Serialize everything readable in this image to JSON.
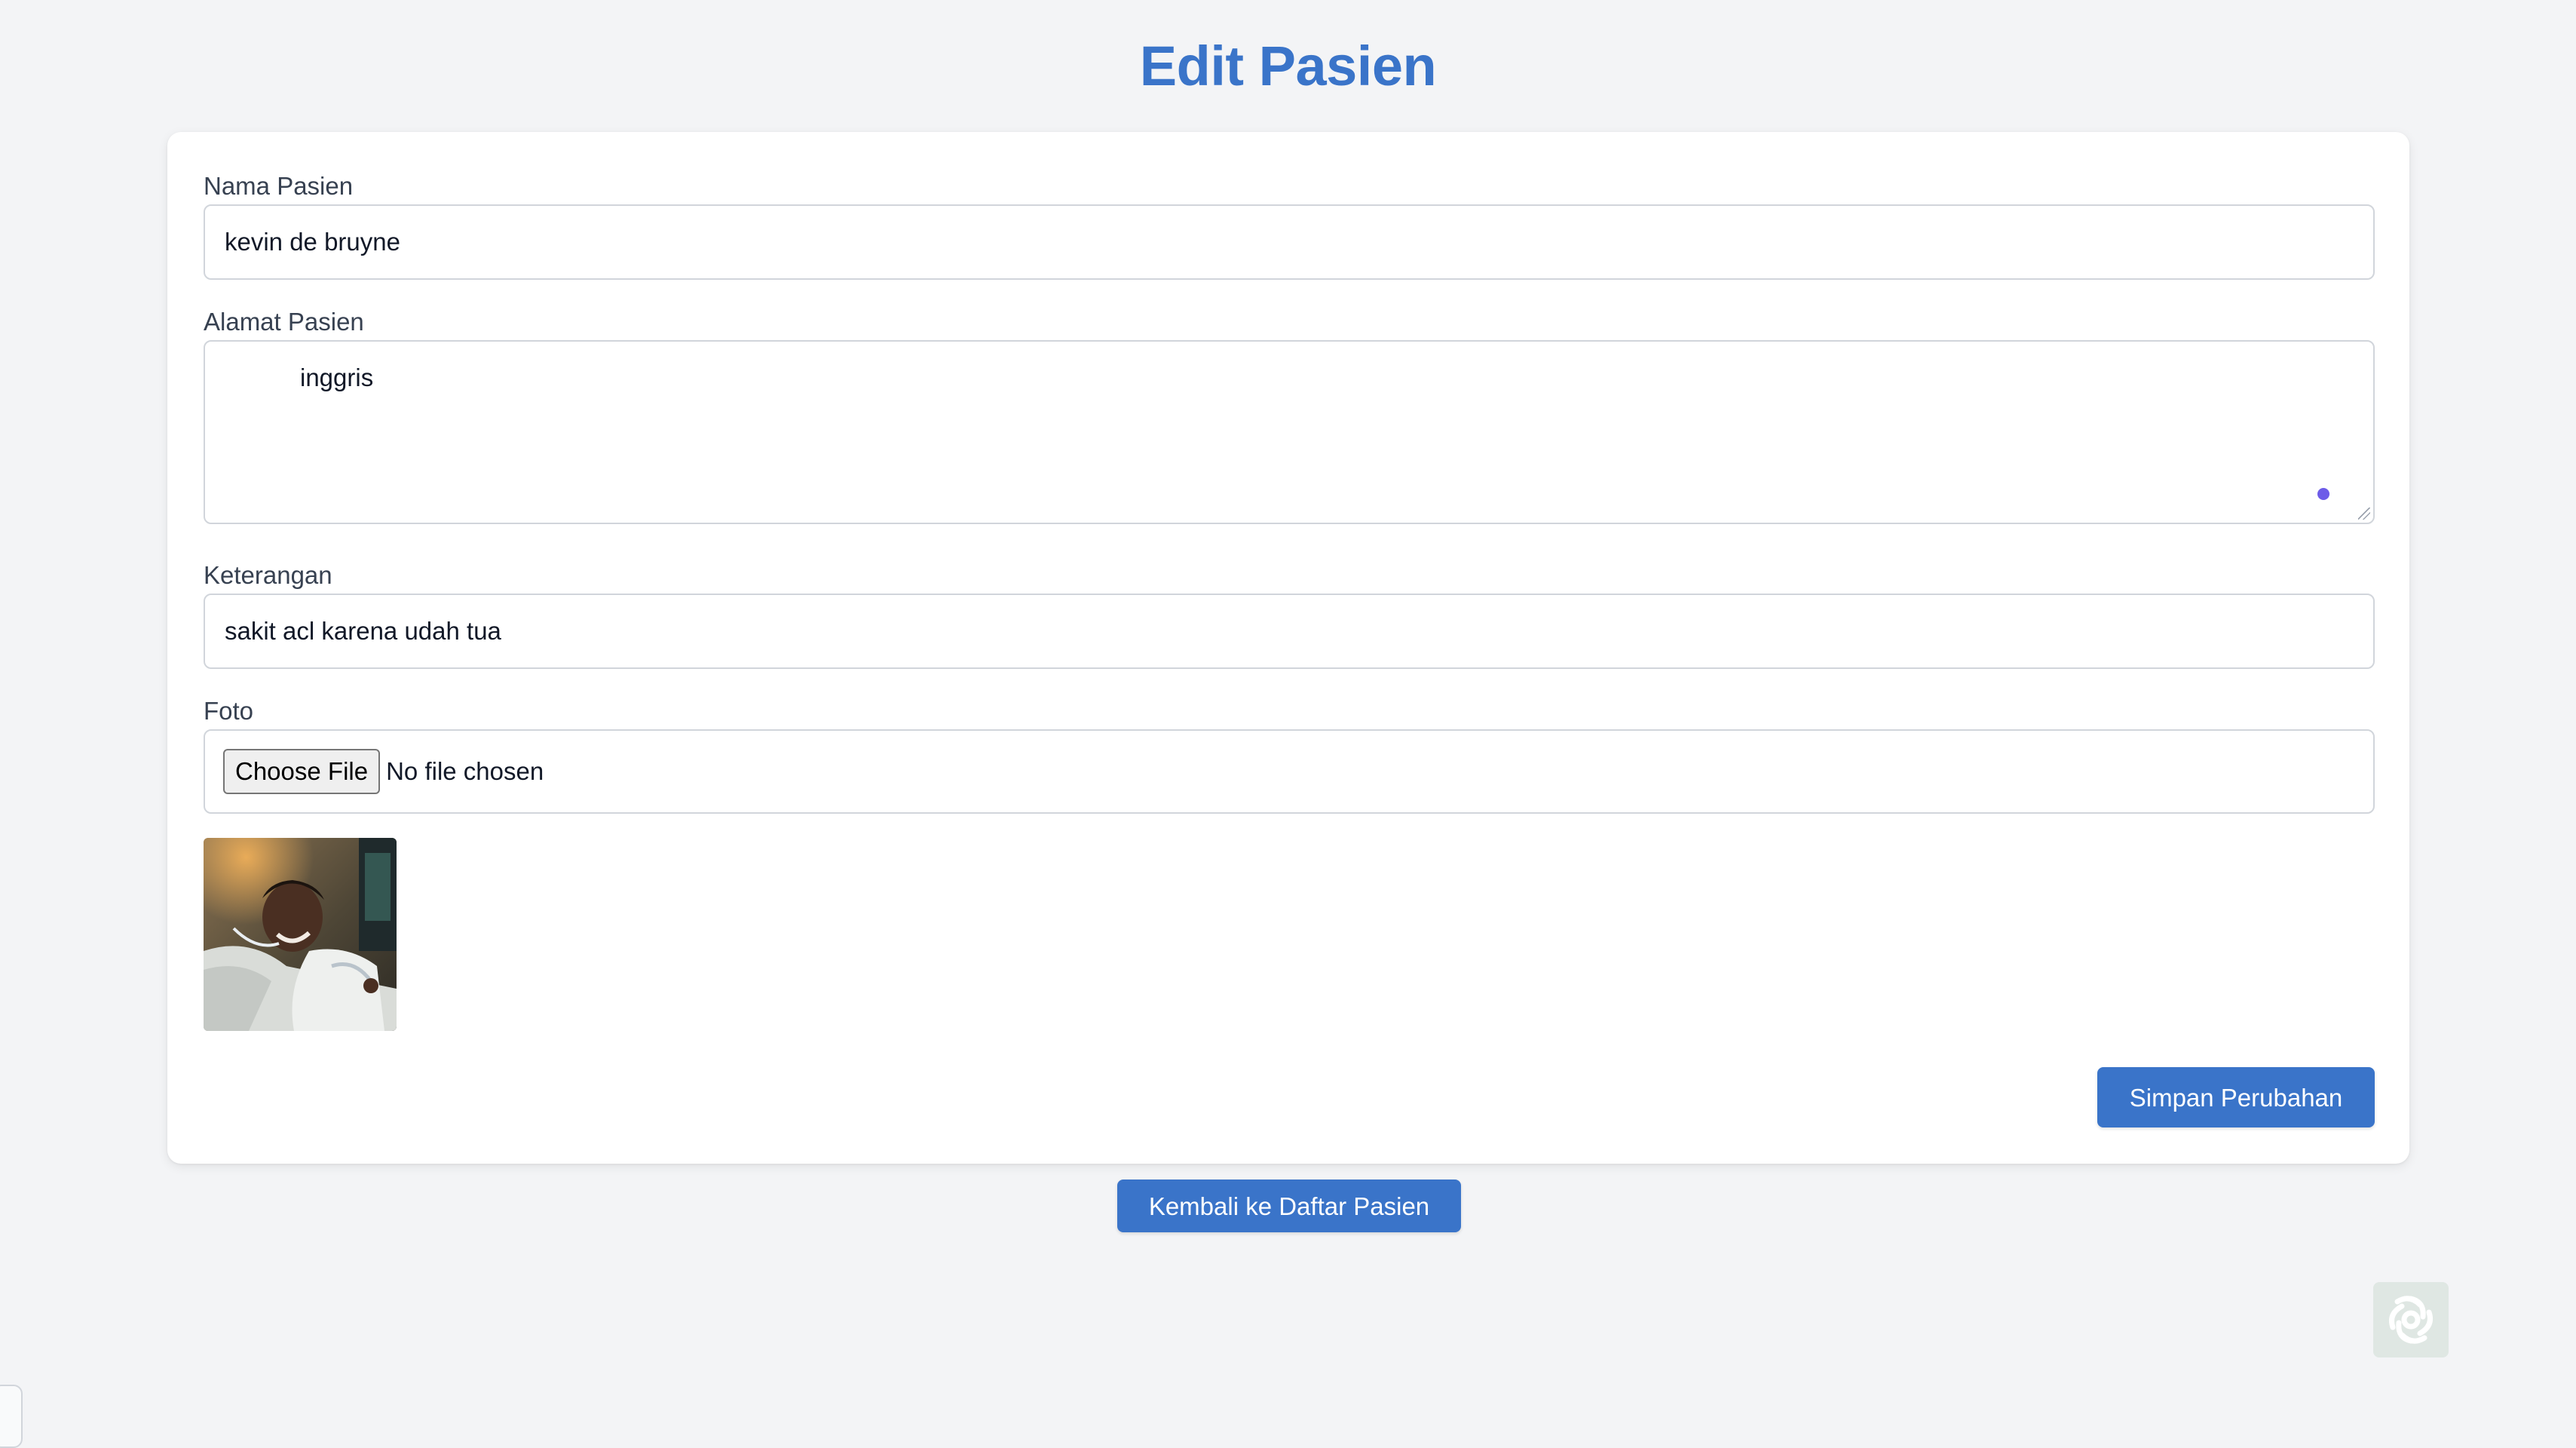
{
  "page": {
    "title": "Edit Pasien"
  },
  "form": {
    "nama": {
      "label": "Nama Pasien",
      "value": "kevin de bruyne"
    },
    "alamat": {
      "label": "Alamat Pasien",
      "value": "inggris"
    },
    "keterangan": {
      "label": "Keterangan",
      "value": "sakit acl karena udah tua"
    },
    "foto": {
      "label": "Foto",
      "button_label": "Choose File",
      "status": "No file chosen"
    },
    "save_label": "Simpan Perubahan"
  },
  "footer": {
    "back_label": "Kembali ke Daftar Pasien"
  },
  "colors": {
    "accent": "#3a74c9",
    "background": "#f3f4f6"
  }
}
